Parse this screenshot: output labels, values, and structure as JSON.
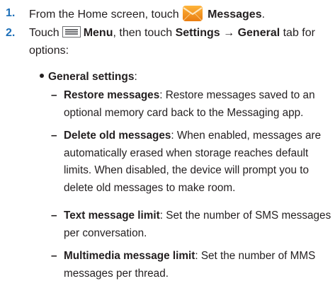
{
  "steps": [
    {
      "number": "1.",
      "prefix": "From the Home screen, touch",
      "icon": "messages-app-icon",
      "bold": "Messages",
      "suffix": "."
    },
    {
      "number": "2.",
      "prefix": "Touch",
      "icon": "menu-icon",
      "bold1": "Menu",
      "middle": ", then touch",
      "bold2": "Settings → General",
      "suffix": "tab for options:"
    }
  ],
  "section": {
    "title": "General settings",
    "colon": ":"
  },
  "items": [
    {
      "name": "Restore messages",
      "description": "Restore messages saved to an optional memory card back to the Messaging app."
    },
    {
      "name": "Delete old messages",
      "description": "When enabled, messages are automatically erased when storage reaches default limits. When disabled, the device will prompt you to delete old messages to make room."
    },
    {
      "name": "Text message limit",
      "description": "Set the number of SMS messages per conversation."
    },
    {
      "name": "Multimedia message limit",
      "description": "Set the number of MMS messages per thread."
    }
  ],
  "colors": {
    "step_number": "#1d6fb8",
    "text": "#231f20",
    "icon_orange": "#f39a1e"
  }
}
